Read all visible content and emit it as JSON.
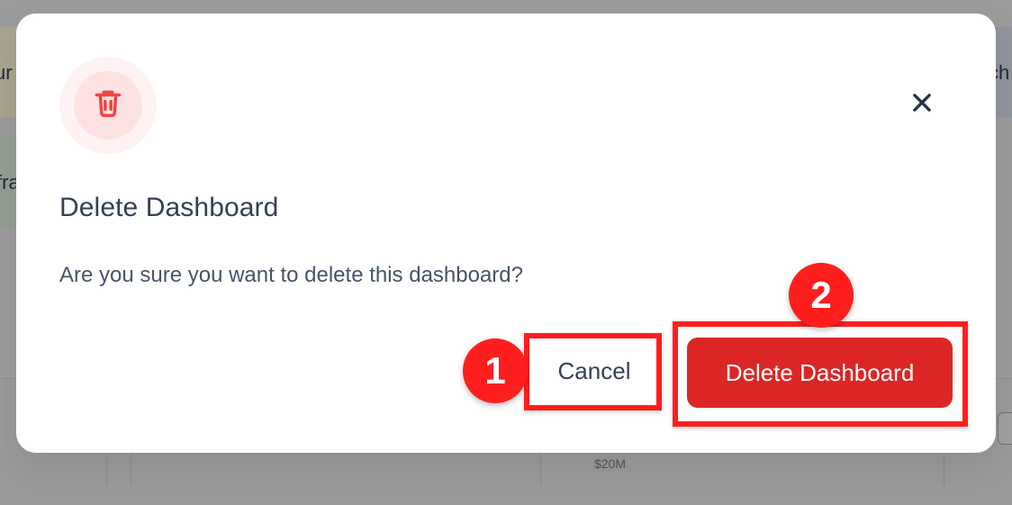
{
  "background": {
    "left_top_partial_text": "ur",
    "left_bottom_partial_text": "fra",
    "right_top_partial_text": "ch",
    "chart_axis_label": "$20M"
  },
  "modal": {
    "title": "Delete Dashboard",
    "message": "Are you sure you want to delete this dashboard?",
    "icon": "trash-icon",
    "close_icon": "close-icon",
    "cancel_label": "Cancel",
    "confirm_label": "Delete Dashboard"
  },
  "annotations": {
    "step_1": "1",
    "step_2": "2"
  },
  "colors": {
    "danger": "#dc2626",
    "danger_soft": "#fee2e2",
    "danger_softer": "#fef2f2",
    "annotation": "#ff1e1e",
    "text_primary": "#334155",
    "text_secondary": "#475569"
  }
}
